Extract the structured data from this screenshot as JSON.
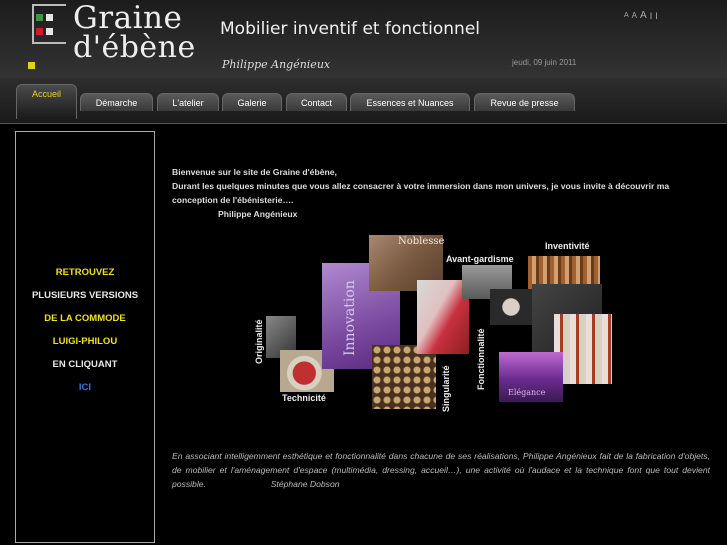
{
  "header": {
    "brand_line1": "Graine",
    "brand_line2": "d'ébène",
    "tagline": "Mobilier inventif et fonctionnel",
    "signature": "Philippe Angénieux",
    "date": "jeudi, 09 juin 2011",
    "font_tools": [
      "A",
      "A",
      "A",
      "I",
      "I"
    ]
  },
  "nav": {
    "tabs": [
      {
        "label": "Accueil",
        "active": true
      },
      {
        "label": "Démarche"
      },
      {
        "label": "L'atelier"
      },
      {
        "label": "Galerie"
      },
      {
        "label": "Contact"
      },
      {
        "label": "Essences et Nuances"
      },
      {
        "label": "Revue de presse"
      }
    ]
  },
  "sidebar": {
    "lines": [
      "RETROUVEZ",
      "PLUSIEURS VERSIONS",
      "DE LA COMMODE",
      "LUIGI-PHILOU",
      "EN CLIQUANT",
      "ICI"
    ]
  },
  "main": {
    "welcome_line1": "Bienvenue sur le site de Graine d'ébène,",
    "welcome_line2": "Durant les quelques minutes que vous allez consacrer à votre immersion dans mon univers, je vous invite à découvrir ma conception de l'ébénisterie….",
    "welcome_sig": "Philippe Angénieux",
    "collage_labels": {
      "noblesse": "Noblesse",
      "innovation": "Innovation",
      "avant_gardisme": "Avant-gardisme",
      "inventivite": "Inventivité",
      "originalite": "Originalité",
      "technicite": "Technicité",
      "singularite": "Singularité",
      "fonctionnalite": "Fonctionnalité",
      "elegance": "Elégance"
    },
    "quote": "En associant intelligemment esthétique et fonctionnalité dans chacune de ses réalisations, Philippe Angénieux fait de la fabrication d'objets, de mobilier et l'aménagement d'espace (multimédia, dressing, accueil…), une activité où l'audace et la technique font que tout devient possible.",
    "quote_author": "Stéphane Dobson"
  },
  "colors": {
    "accent_yellow": "#f0e020",
    "link_blue": "#3a7ad0"
  }
}
